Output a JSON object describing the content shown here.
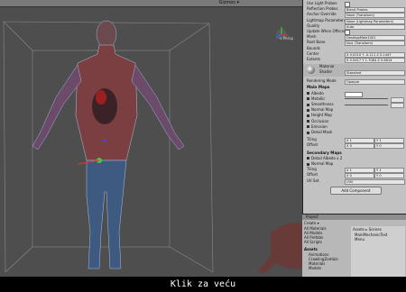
{
  "scene": {
    "gizmos_label": "Gizmos ▾",
    "persp_label": "< Persp"
  },
  "inspector": {
    "rows_top": [
      {
        "label": "Use Light Probes",
        "value": "",
        "kind": "check"
      },
      {
        "label": "Reflection Probes",
        "value": "Blend Probes",
        "kind": "field"
      },
      {
        "label": "Anchor Override",
        "value": "None (Transform)",
        "kind": "field"
      },
      {
        "label": "Lightmap Parameters",
        "value": "None (Lightmap Parameters)",
        "kind": "field"
      },
      {
        "label": "Quality",
        "value": "Auto",
        "kind": "field"
      },
      {
        "label": "Update When Offscreen",
        "value": "",
        "kind": "check"
      },
      {
        "label": "Mesh",
        "value": "DesktopMale1001",
        "kind": "field"
      },
      {
        "label": "Root Bone",
        "value": "hips (Transform)",
        "kind": "field"
      },
      {
        "label": "Bounds",
        "value": "",
        "kind": "none"
      },
      {
        "label": "Center",
        "value": "X 0.0210  Y -0.111  Z 0.1447",
        "kind": "field"
      },
      {
        "label": "Extents",
        "value": "X 0.9417  Y 1.7084  Z 0.6814",
        "kind": "field"
      }
    ],
    "material": {
      "name": "Material",
      "shader_label": "Shader",
      "shader_value": "Standard"
    },
    "rendering_mode": {
      "label": "Rendering Mode",
      "value": "Opaque"
    },
    "main_maps_title": "Main Maps",
    "main_maps": [
      "Albedo",
      "Metallic",
      "Smoothness",
      "Normal Map",
      "Height Map",
      "Occlusion",
      "Emission",
      "Detail Mask"
    ],
    "tiling_label": "Tiling",
    "offset_label": "Offset",
    "tiling_values": [
      "X 1",
      "Y 1"
    ],
    "offset_values": [
      "X 0",
      "Y 0"
    ],
    "secondary_title": "Secondary Maps",
    "secondary_maps": [
      "Detail Albedo x 2",
      "Normal Map"
    ],
    "uv_set_label": "UV Set",
    "uv_set_value": "UV0",
    "add_component": "Add Component"
  },
  "project": {
    "tab": "Project",
    "create": "Create ▾",
    "favorites": [
      "All Materials",
      "All Models",
      "All Prefabs",
      "All Scripts"
    ],
    "assets_label": "Assets",
    "assets_folders": [
      "Animations",
      "CrawlingZombie",
      "Materials",
      "Models"
    ],
    "breadcrumb": "Assets ▸ Scenes",
    "files": [
      "MainMechanicTest",
      "Menu"
    ]
  },
  "caption": "Klik za veću"
}
